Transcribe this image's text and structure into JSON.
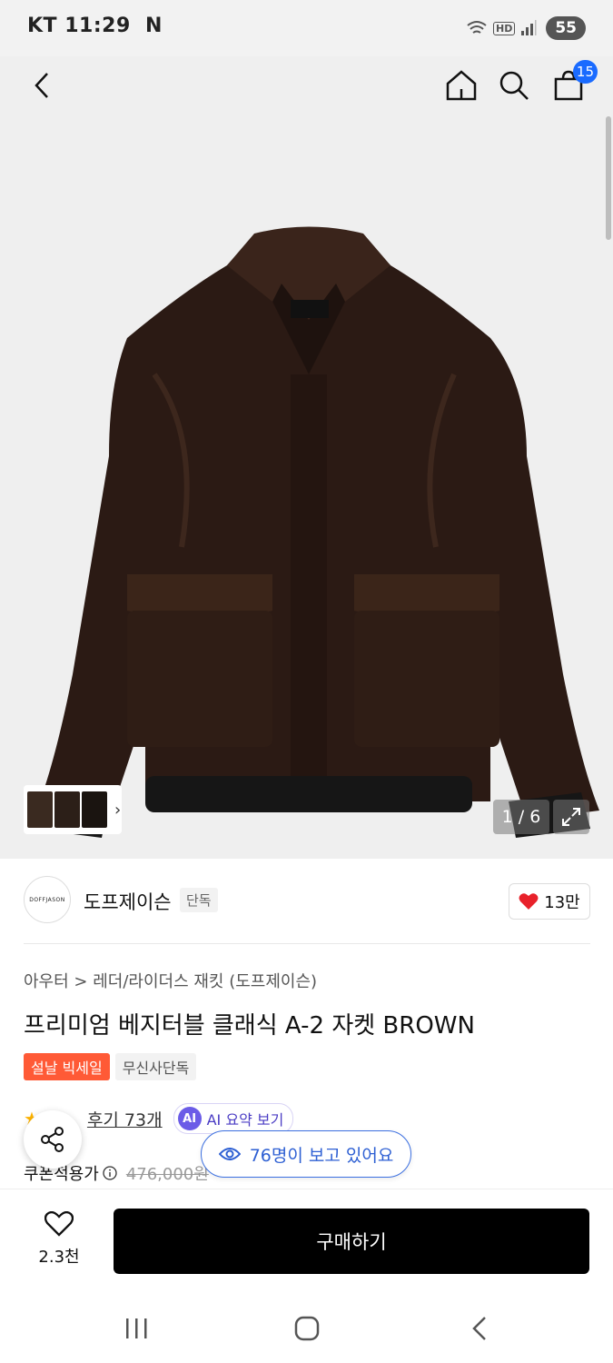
{
  "status_bar": {
    "carrier": "KT",
    "time": "11:29",
    "notification": "N",
    "network": "HD",
    "battery": "55"
  },
  "header": {
    "cart_count": "15"
  },
  "gallery": {
    "page_counter": "1 / 6",
    "total_images": 6,
    "current_image": 1
  },
  "brand": {
    "logo_text": "DOFFJASON",
    "name": "도프제이슨",
    "tag": "단독",
    "likes": "13만"
  },
  "product": {
    "breadcrumb": "아우터 > 레더/라이더스 재킷 (도프제이슨)",
    "title": "프리미엄 베지터블 클래식 A-2 자켓 BROWN",
    "tags": [
      "설날 빅세일",
      "무신사단독"
    ],
    "review_link": "후기 73개",
    "ai_badge": "AI",
    "ai_summary": "AI 요약 보기",
    "price_label": "쿠폰적용가",
    "original_price": "476,000원"
  },
  "viewers": {
    "text": "76명이 보고 있어요"
  },
  "bottom_bar": {
    "wish_count": "2.3천",
    "buy_label": "구매하기"
  },
  "colors": {
    "accent_blue": "#1a6bff",
    "sale_red": "#ff5a36",
    "ai_purple": "#6b5ce7",
    "heart_red": "#e8212a"
  }
}
